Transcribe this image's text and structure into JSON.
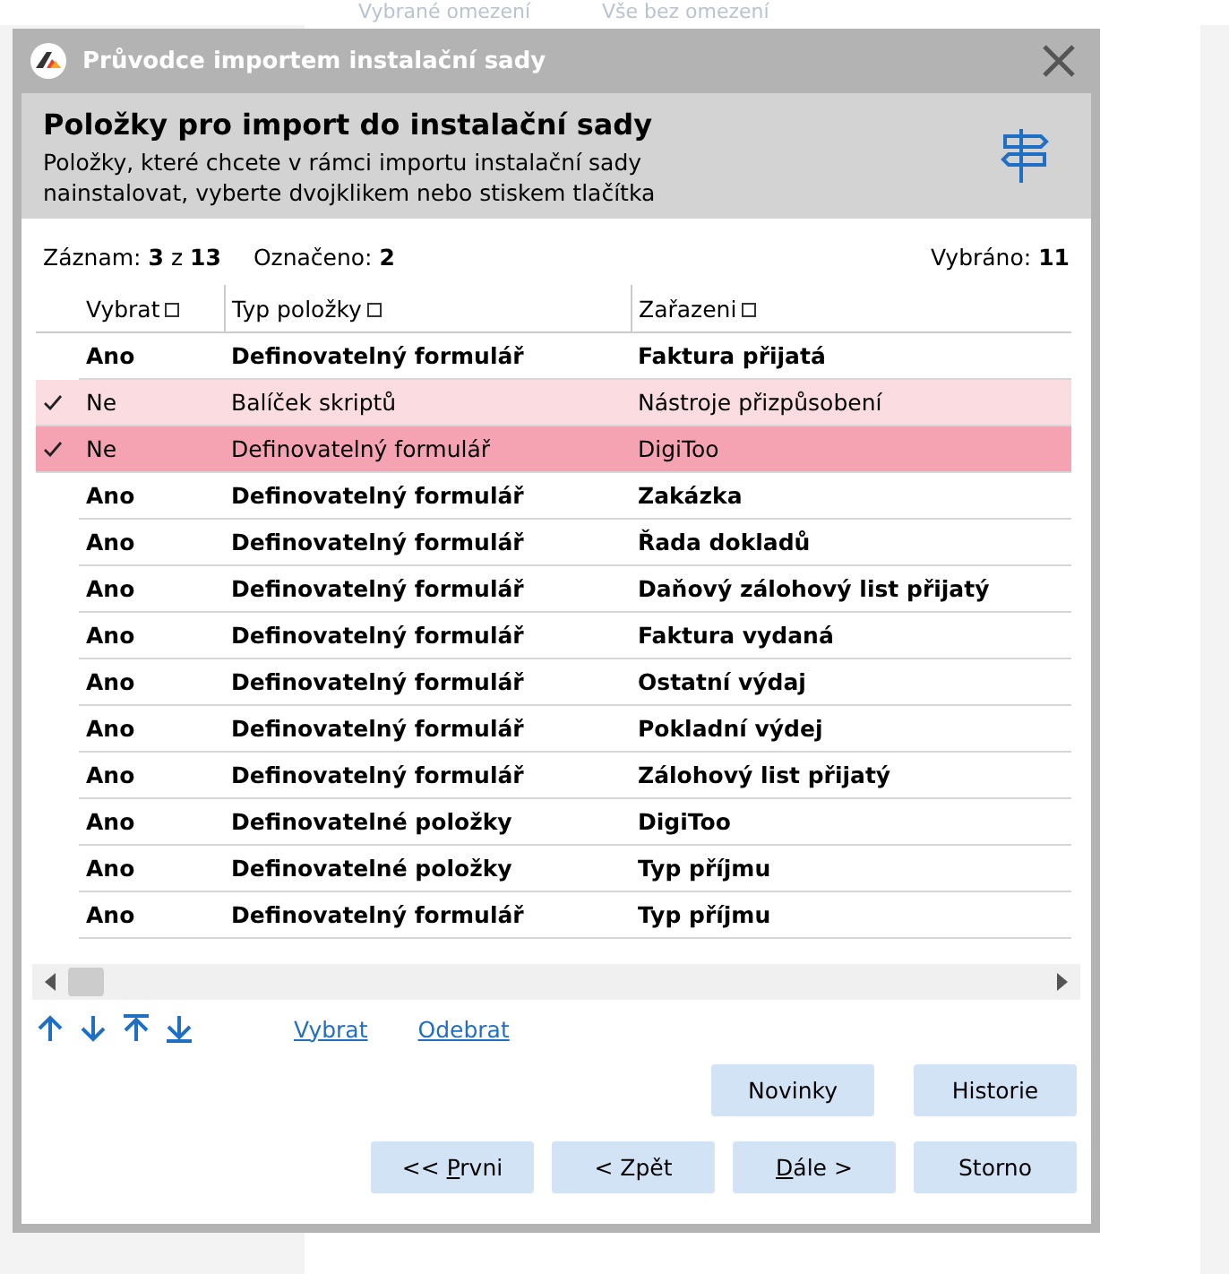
{
  "background": {
    "texts": [
      "Vybrané omezení",
      "Vše bez omezení"
    ]
  },
  "window": {
    "title": "Průvodce importem instalační sady"
  },
  "header": {
    "title": "Položky pro import do instalační sady",
    "description": [
      "Položky, které chcete v rámci importu instalační sady",
      "nainstalovat, vyberte dvojklikem nebo stiskem tlačítka"
    ]
  },
  "summary": {
    "record_label": "Záznam:",
    "record": "3",
    "of": "z",
    "total": "13",
    "marked_label": "Označeno:",
    "marked": "2",
    "selected_label": "Vybráno:",
    "selected_count": "11"
  },
  "table": {
    "columns": [
      "Vybrat",
      "Typ položky",
      "Zařazeni"
    ],
    "rows": [
      {
        "checked": false,
        "selected": false,
        "cells": [
          "Ano",
          "Definovatelný formulář",
          "Faktura přijatá"
        ]
      },
      {
        "checked": true,
        "selected": false,
        "cells": [
          "Ne",
          "Balíček skriptů",
          "Nástroje přizpůsobení"
        ]
      },
      {
        "checked": true,
        "selected": true,
        "cells": [
          "Ne",
          "Definovatelný formulář",
          "DigiToo"
        ]
      },
      {
        "checked": false,
        "selected": false,
        "cells": [
          "Ano",
          "Definovatelný formulář",
          "Zakázka"
        ]
      },
      {
        "checked": false,
        "selected": false,
        "cells": [
          "Ano",
          "Definovatelný formulář",
          "Řada dokladů"
        ]
      },
      {
        "checked": false,
        "selected": false,
        "cells": [
          "Ano",
          "Definovatelný formulář",
          "Daňový zálohový list přijatý"
        ]
      },
      {
        "checked": false,
        "selected": false,
        "cells": [
          "Ano",
          "Definovatelný formulář",
          "Faktura vydaná"
        ]
      },
      {
        "checked": false,
        "selected": false,
        "cells": [
          "Ano",
          "Definovatelný formulář",
          "Ostatní výdaj"
        ]
      },
      {
        "checked": false,
        "selected": false,
        "cells": [
          "Ano",
          "Definovatelný formulář",
          "Pokladní výdej"
        ]
      },
      {
        "checked": false,
        "selected": false,
        "cells": [
          "Ano",
          "Definovatelný formulář",
          "Zálohový list přijatý"
        ]
      },
      {
        "checked": false,
        "selected": false,
        "cells": [
          "Ano",
          "Definovatelné položky",
          "DigiToo"
        ]
      },
      {
        "checked": false,
        "selected": false,
        "cells": [
          "Ano",
          "Definovatelné položky",
          "Typ příjmu"
        ]
      },
      {
        "checked": false,
        "selected": false,
        "cells": [
          "Ano",
          "Definovatelný formulář",
          "Typ příjmu"
        ]
      }
    ]
  },
  "links": [
    "Vybrat",
    "Odebrat"
  ],
  "buttons_top": [
    "Novinky",
    "Historie"
  ],
  "buttons_bottom": [
    {
      "pre": "<< ",
      "key": "P",
      "post": "rvni"
    },
    {
      "pre": "< Zpět"
    },
    {
      "key": "D",
      "post": "ále >"
    },
    {
      "pre": "Storno"
    }
  ]
}
